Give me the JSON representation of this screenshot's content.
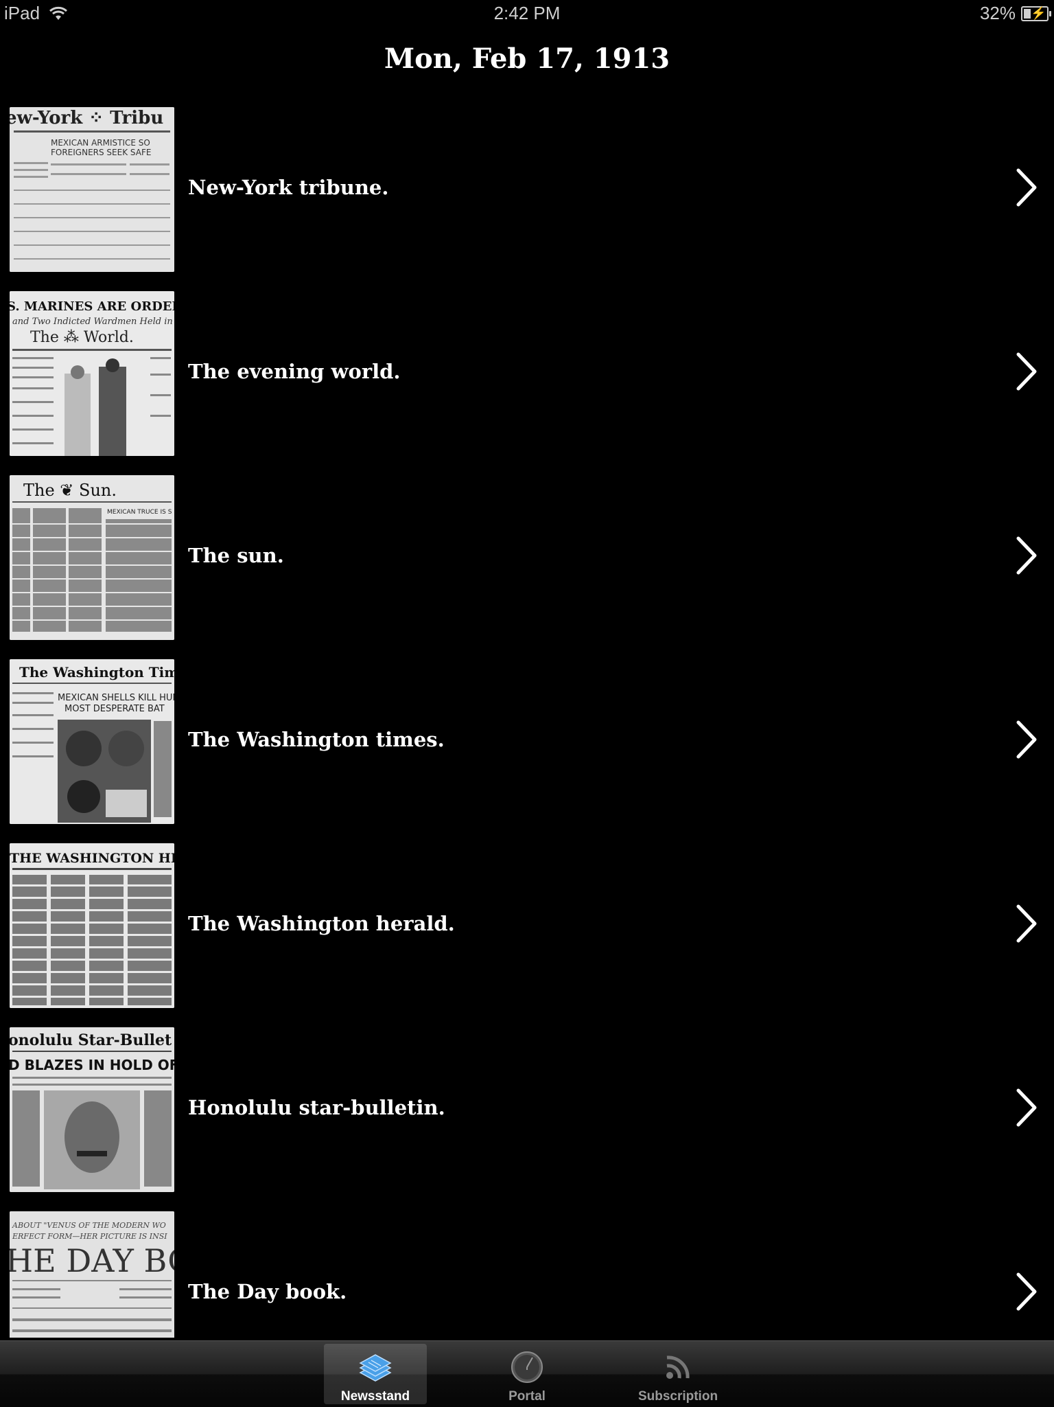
{
  "status": {
    "device": "iPad",
    "time": "2:42 PM",
    "battery": "32%"
  },
  "title": "Mon, Feb 17, 1913",
  "papers": [
    {
      "name": "New-York tribune.",
      "masthead": "ew-York ... Tribu",
      "headline": "MEXICAN ARMISTICE SO FOREIGNERS SEEK SAFE"
    },
    {
      "name": "The evening world.",
      "masthead": "The World.",
      "headline": "S. MARINES ARE ORDERED FOR"
    },
    {
      "name": "The sun.",
      "masthead": "The Sun.",
      "headline": "MEXICAN TRUCE IS S"
    },
    {
      "name": "The Washington times.",
      "masthead": "The Washington Times",
      "headline": "MEXICAN SHELLS KILL HUN MOST DESPERATE BAT"
    },
    {
      "name": "The Washington herald.",
      "masthead": "THE WASHINGTON HERALD",
      "headline": ""
    },
    {
      "name": "Honolulu star-bulletin.",
      "masthead": "Honolulu Star-Bullet",
      "headline": "D BLAZES IN HOLD OF MAU"
    },
    {
      "name": "The Day book.",
      "masthead": "HE DAY BOO",
      "headline": "ABOUT VENUS OF THE MODERN WO"
    }
  ],
  "tabs": [
    {
      "label": "Newsstand",
      "icon": "newsstand-icon",
      "active": true
    },
    {
      "label": "Portal",
      "icon": "portal-clock-icon",
      "active": false
    },
    {
      "label": "Subscription",
      "icon": "rss-icon",
      "active": false
    }
  ],
  "colors": {
    "background": "#000000",
    "text": "#ffffff",
    "muted": "#9a9a9a",
    "tab_icon_active": "#4aa0e8"
  }
}
